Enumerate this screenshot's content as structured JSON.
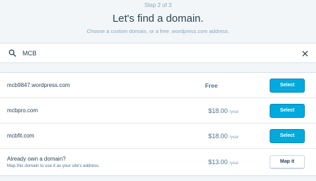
{
  "header": {
    "step": "Step 2 of 3",
    "title": "Let's find a domain.",
    "subtitle": "Choose a custom domain, or a free .wordpress.com address."
  },
  "search": {
    "value": "MCB",
    "icon": "search-icon",
    "clear_icon": "close-icon"
  },
  "results": [
    {
      "domain": "mcb9847.wordpress.com",
      "price": "Free",
      "unit": "",
      "button": "Select"
    },
    {
      "domain": "mcbpro.com",
      "price": "$18.00",
      "unit": "/year",
      "button": "Select"
    },
    {
      "domain": "mcbfit.com",
      "price": "$18.00",
      "unit": "/year",
      "button": "Select"
    }
  ],
  "map_domain": {
    "title": "Already own a domain?",
    "description": "Map this domain to use it as your site's address.",
    "price": "$13.00",
    "unit": "/year",
    "button": "Map it"
  },
  "colors": {
    "primary": "#00aadc",
    "background": "#f3f6f8",
    "text": "#2e4453",
    "muted": "#87a6bc"
  }
}
